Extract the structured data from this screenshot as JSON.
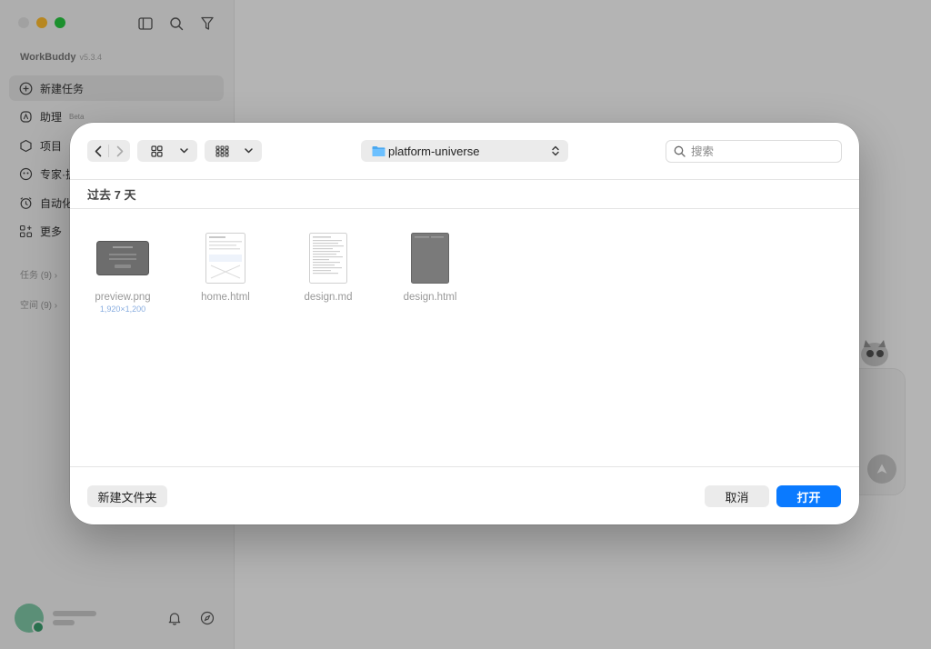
{
  "app": {
    "name": "WorkBuddy",
    "version": "v5.3.4"
  },
  "sidebar": {
    "items": [
      {
        "label": "新建任务",
        "icon": "plus-circle-icon"
      },
      {
        "label": "助理",
        "badge": "Beta",
        "icon": "assistant-icon"
      },
      {
        "label": "项目",
        "icon": "project-icon"
      },
      {
        "label": "专家·扩",
        "icon": "expert-icon"
      },
      {
        "label": "自动化",
        "icon": "alarm-clock-icon"
      },
      {
        "label": "更多",
        "icon": "apps-plus-icon"
      }
    ],
    "sections": [
      {
        "label": "任务 (9)"
      },
      {
        "label": "空间 (9)"
      }
    ]
  },
  "dialog": {
    "toolbar": {
      "location": "platform-universe",
      "search_placeholder": "搜索"
    },
    "group_header": "过去 7 天",
    "files": [
      {
        "name": "preview.png",
        "meta": "1,920×1,200",
        "kind": "image-thumbnail"
      },
      {
        "name": "home.html",
        "meta": "",
        "kind": "html-thumbnail"
      },
      {
        "name": "design.md",
        "meta": "",
        "kind": "text-thumbnail"
      },
      {
        "name": "design.html",
        "meta": "",
        "kind": "dark-page-thumbnail"
      }
    ],
    "buttons": {
      "new_folder": "新建文件夹",
      "cancel": "取消",
      "open": "打开"
    }
  },
  "colors": {
    "accent": "#0a7aff",
    "overlay": "rgba(0,0,0,0.28)"
  }
}
